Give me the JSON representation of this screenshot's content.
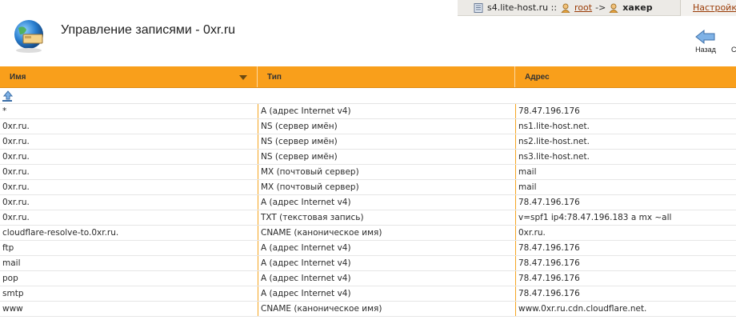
{
  "topbar": {
    "server": "s4.lite-host.ru ::",
    "user": "root",
    "arrow": "->",
    "target_user": "хакер",
    "settings_label": "Настройки"
  },
  "header": {
    "title": "Управление записями - 0xr.ru",
    "back_label": "Назад",
    "edge_label": "С"
  },
  "table": {
    "columns": [
      "Имя",
      "Тип",
      "Адрес"
    ],
    "rows": [
      {
        "name": "*",
        "type": "A (адрес Internet v4)",
        "address": "78.47.196.176"
      },
      {
        "name": "0xr.ru.",
        "type": "NS (сервер имён)",
        "address": "ns1.lite-host.net."
      },
      {
        "name": "0xr.ru.",
        "type": "NS (сервер имён)",
        "address": "ns2.lite-host.net."
      },
      {
        "name": "0xr.ru.",
        "type": "NS (сервер имён)",
        "address": "ns3.lite-host.net."
      },
      {
        "name": "0xr.ru.",
        "type": "MX (почтовый сервер)",
        "address": "mail"
      },
      {
        "name": "0xr.ru.",
        "type": "MX (почтовый сервер)",
        "address": "mail"
      },
      {
        "name": "0xr.ru.",
        "type": "A (адрес Internet v4)",
        "address": "78.47.196.176"
      },
      {
        "name": "0xr.ru.",
        "type": "TXT (текстовая запись)",
        "address": "v=spf1 ip4:78.47.196.183 a mx ~all"
      },
      {
        "name": "cloudflare-resolve-to.0xr.ru.",
        "type": "CNAME (каноническое имя)",
        "address": "0xr.ru."
      },
      {
        "name": "ftp",
        "type": "A (адрес Internet v4)",
        "address": "78.47.196.176"
      },
      {
        "name": "mail",
        "type": "A (адрес Internet v4)",
        "address": "78.47.196.176"
      },
      {
        "name": "pop",
        "type": "A (адрес Internet v4)",
        "address": "78.47.196.176"
      },
      {
        "name": "smtp",
        "type": "A (адрес Internet v4)",
        "address": "78.47.196.176"
      },
      {
        "name": "www",
        "type": "CNAME (каноническое имя)",
        "address": "www.0xr.ru.cdn.cloudflare.net."
      }
    ]
  },
  "colors": {
    "header_orange": "#f99f1b",
    "link": "#9a3b06"
  }
}
